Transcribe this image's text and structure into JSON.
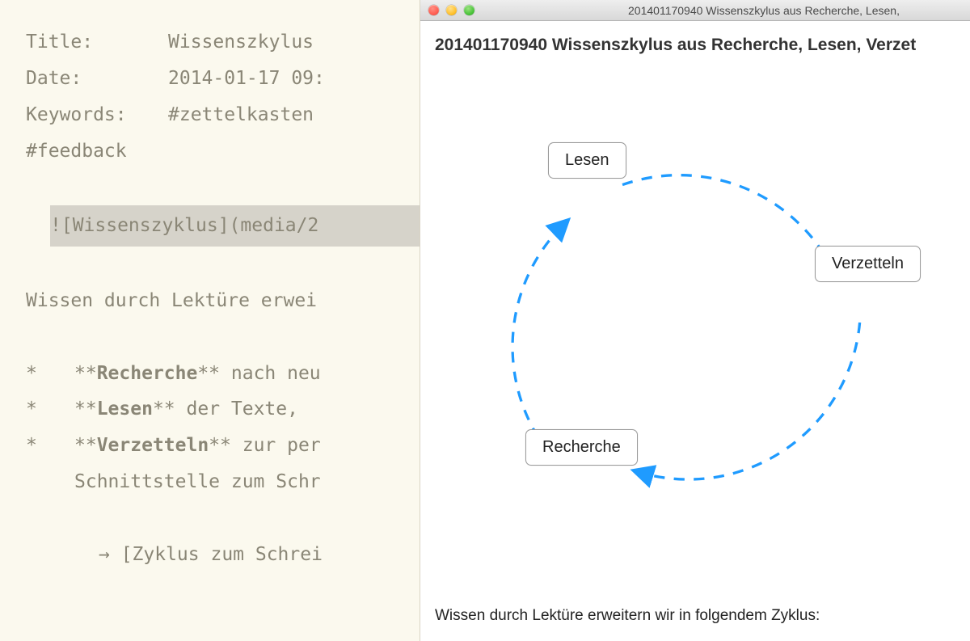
{
  "editor": {
    "meta": {
      "title_label": "Title:",
      "title_value": "Wissenszkylus",
      "date_label": "Date:",
      "date_value": "2014-01-17 09:",
      "keywords_label": "Keywords:",
      "keywords_value": "#zettelkasten",
      "keywords_line2": "#feedback"
    },
    "image_line": "![Wissenszyklus](media/2",
    "paragraph": "Wissen durch Lektüre erwei",
    "bullets": [
      {
        "bold": "Recherche",
        "rest": " nach neu"
      },
      {
        "bold": "Lesen",
        "rest": " der Texte,"
      },
      {
        "bold": "Verzetteln",
        "rest": " zur per"
      }
    ],
    "bullet_cont": "Schnittstelle zum Schr",
    "arrow_line": "→ [Zyklus zum Schrei"
  },
  "preview": {
    "window_title": "201401170940 Wissenszkylus aus Recherche, Lesen,",
    "heading": "201401170940 Wissenszkylus aus Recherche, Lesen, Verzet",
    "diagram": {
      "nodes": {
        "lesen": "Lesen",
        "verzetteln": "Verzetteln",
        "recherche": "Recherche"
      },
      "arrow_color": "#1f9bff"
    },
    "paragraph": "Wissen durch Lektüre erweitern wir in folgendem Zyklus:"
  }
}
